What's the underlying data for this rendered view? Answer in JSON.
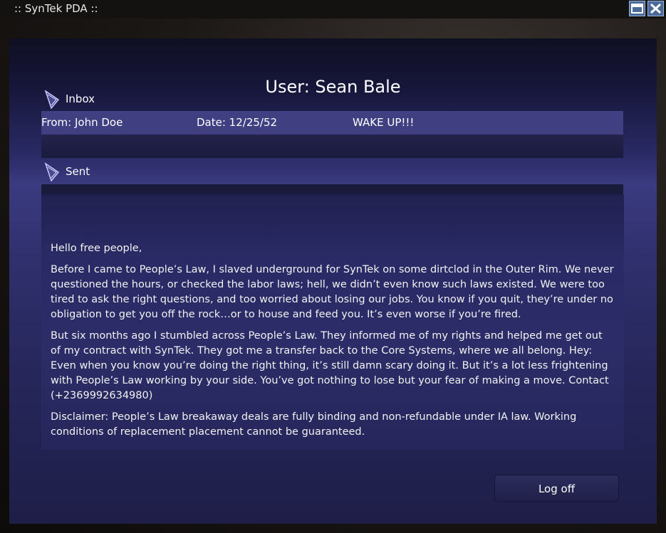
{
  "window": {
    "title": ":: SynTek PDA ::",
    "restore_icon": "restore-icon",
    "close_icon": "close-icon"
  },
  "header": {
    "user_title": "User: Sean Bale"
  },
  "folders": {
    "inbox": {
      "label": "Inbox",
      "icon": "folder-arrow-icon"
    },
    "sent": {
      "label": "Sent",
      "icon": "folder-arrow-icon"
    }
  },
  "inbox_messages": [
    {
      "from": "From: John Doe",
      "date": "Date: 12/25/52",
      "subject": "WAKE UP!!!"
    }
  ],
  "message": {
    "paragraphs": [
      "Hello free people,",
      "Before I came to People’s Law, I slaved underground for SynTek on some dirtclod in the Outer Rim.  We never questioned the hours, or checked the labor laws; hell, we didn’t even know such laws existed.  We were too tired to ask the right questions, and too worried about losing our jobs.  You know if you quit, they’re under no obligation to get you off the rock…or to house and feed you.  It’s even worse if you’re fired.",
      "But six months ago I stumbled across People’s Law.  They informed me of my rights and helped me get out of my contract with SynTek.  They got me a transfer back to the Core Systems, where we all belong.  Hey:  Even when you know you’re doing the right thing, it’s still damn scary doing it.  But it’s a lot less frightening with People’s Law working by your side. You’ve got nothing to lose but your fear of making a move.  Contact (+2369992634980)",
      "Disclaimer:  People’s Law breakaway deals are fully binding and non-refundable under IA law.  Working conditions of replacement placement cannot be guaranteed."
    ]
  },
  "buttons": {
    "logoff_label": "Log off"
  },
  "colors": {
    "accent": "#3f3f82",
    "panel": "#2a2a66"
  }
}
